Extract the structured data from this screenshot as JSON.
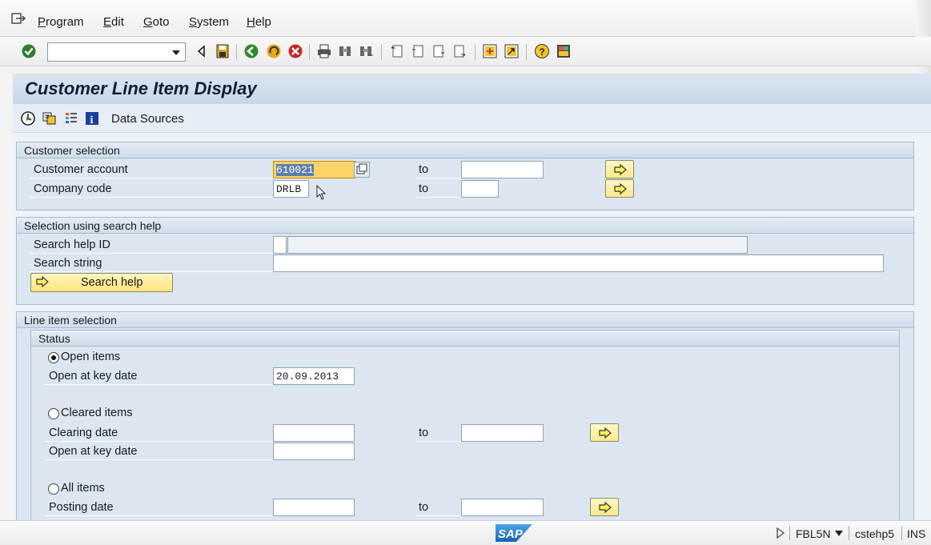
{
  "menu": {
    "items": [
      {
        "label": "Program",
        "underline": "P",
        "rest": "rogram"
      },
      {
        "label": "Edit",
        "underline": "E",
        "rest": "dit"
      },
      {
        "label": "Goto",
        "underline": "G",
        "rest": "oto"
      },
      {
        "label": "System",
        "underline": "S",
        "rest": "ystem"
      },
      {
        "label": "Help",
        "underline": "H",
        "rest": "elp"
      }
    ]
  },
  "toolbar": {
    "command_value": "",
    "icons": [
      "enter-icon",
      "back-arrow-icon",
      "save-icon",
      "back-icon",
      "exit-icon",
      "cancel-icon",
      "print-icon",
      "find-icon",
      "find-next-icon",
      "first-page-icon",
      "previous-page-icon",
      "next-page-icon",
      "last-page-icon",
      "create-session-icon",
      "shortcut-icon",
      "help-icon",
      "customize-layout-icon"
    ]
  },
  "title": "Customer Line Item Display",
  "app_toolbar": {
    "data_sources": "Data Sources"
  },
  "customer_selection": {
    "title": "Customer selection",
    "customer_account_label": "Customer account",
    "customer_account_value": "610021",
    "customer_account_to": "to",
    "customer_account_to_value": "",
    "company_code_label": "Company code",
    "company_code_value": "DRLB",
    "company_code_to": "to",
    "company_code_to_value": ""
  },
  "search_help": {
    "title": "Selection using search help",
    "id_label": "Search help ID",
    "id_value": "",
    "id_desc": "",
    "string_label": "Search string",
    "string_value": "",
    "button_label": "Search help"
  },
  "line_item": {
    "title": "Line item selection",
    "status_title": "Status",
    "open_items": "Open items",
    "open_key_date_label": "Open at key date",
    "open_key_date_value": "20.09.2013",
    "cleared_items": "Cleared items",
    "clearing_date_label": "Clearing date",
    "clearing_to": "to",
    "cleared_key_date_label": "Open at key date",
    "all_items": "All items",
    "posting_date_label": "Posting date",
    "posting_to": "to",
    "selected": "open"
  },
  "statusbar": {
    "logo": "SAP",
    "transaction": "FBL5N",
    "server": "cstehp5",
    "mode": "INS"
  },
  "colors": {
    "group_bg": "#dbe6f1",
    "title_bg": "#c8d7e6",
    "button_yellow": "#ffe98a"
  }
}
